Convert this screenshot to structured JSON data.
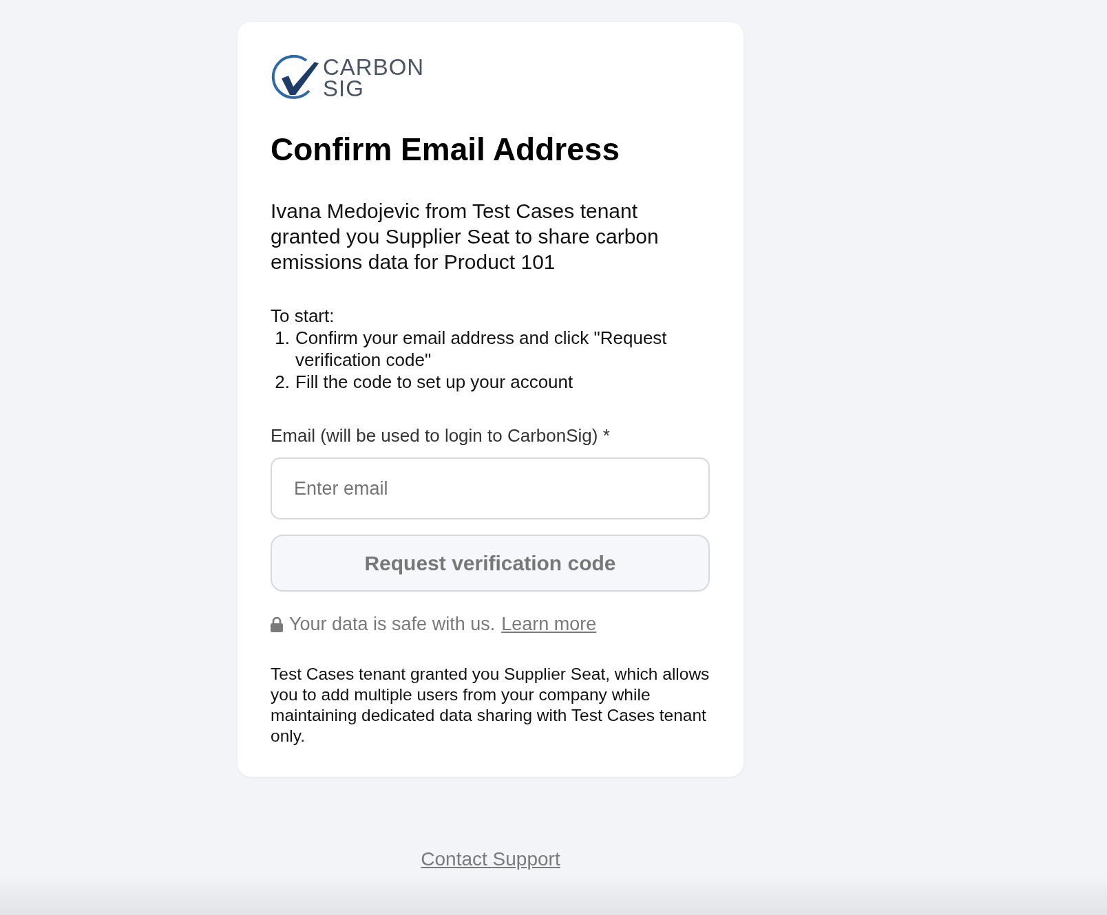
{
  "logo": {
    "line_1": "CARBON",
    "line_2": "SIG"
  },
  "title": "Confirm Email Address",
  "intro": "Ivana Medojevic from Test Cases tenant granted you Supplier Seat to share carbon emissions data for Product 101",
  "steps": {
    "heading": "To start:",
    "items": [
      {
        "number": "1.",
        "text": "Confirm your email address and click \"Request verification code\""
      },
      {
        "number": "2.",
        "text": "Fill the code to set up your account"
      }
    ]
  },
  "email_field": {
    "label": "Email (will be used to login to CarbonSig) *",
    "placeholder": "Enter email"
  },
  "request_button": {
    "label": "Request verification code",
    "disabled": true
  },
  "safety_note": {
    "text": "Your data is safe with us.",
    "link": "Learn more"
  },
  "footnote": "Test Cases tenant granted you Supplier Seat, which allows you to add multiple users from your company while maintaining dedicated data sharing with Test Cases tenant only.",
  "footer_link": "Contact Support"
}
